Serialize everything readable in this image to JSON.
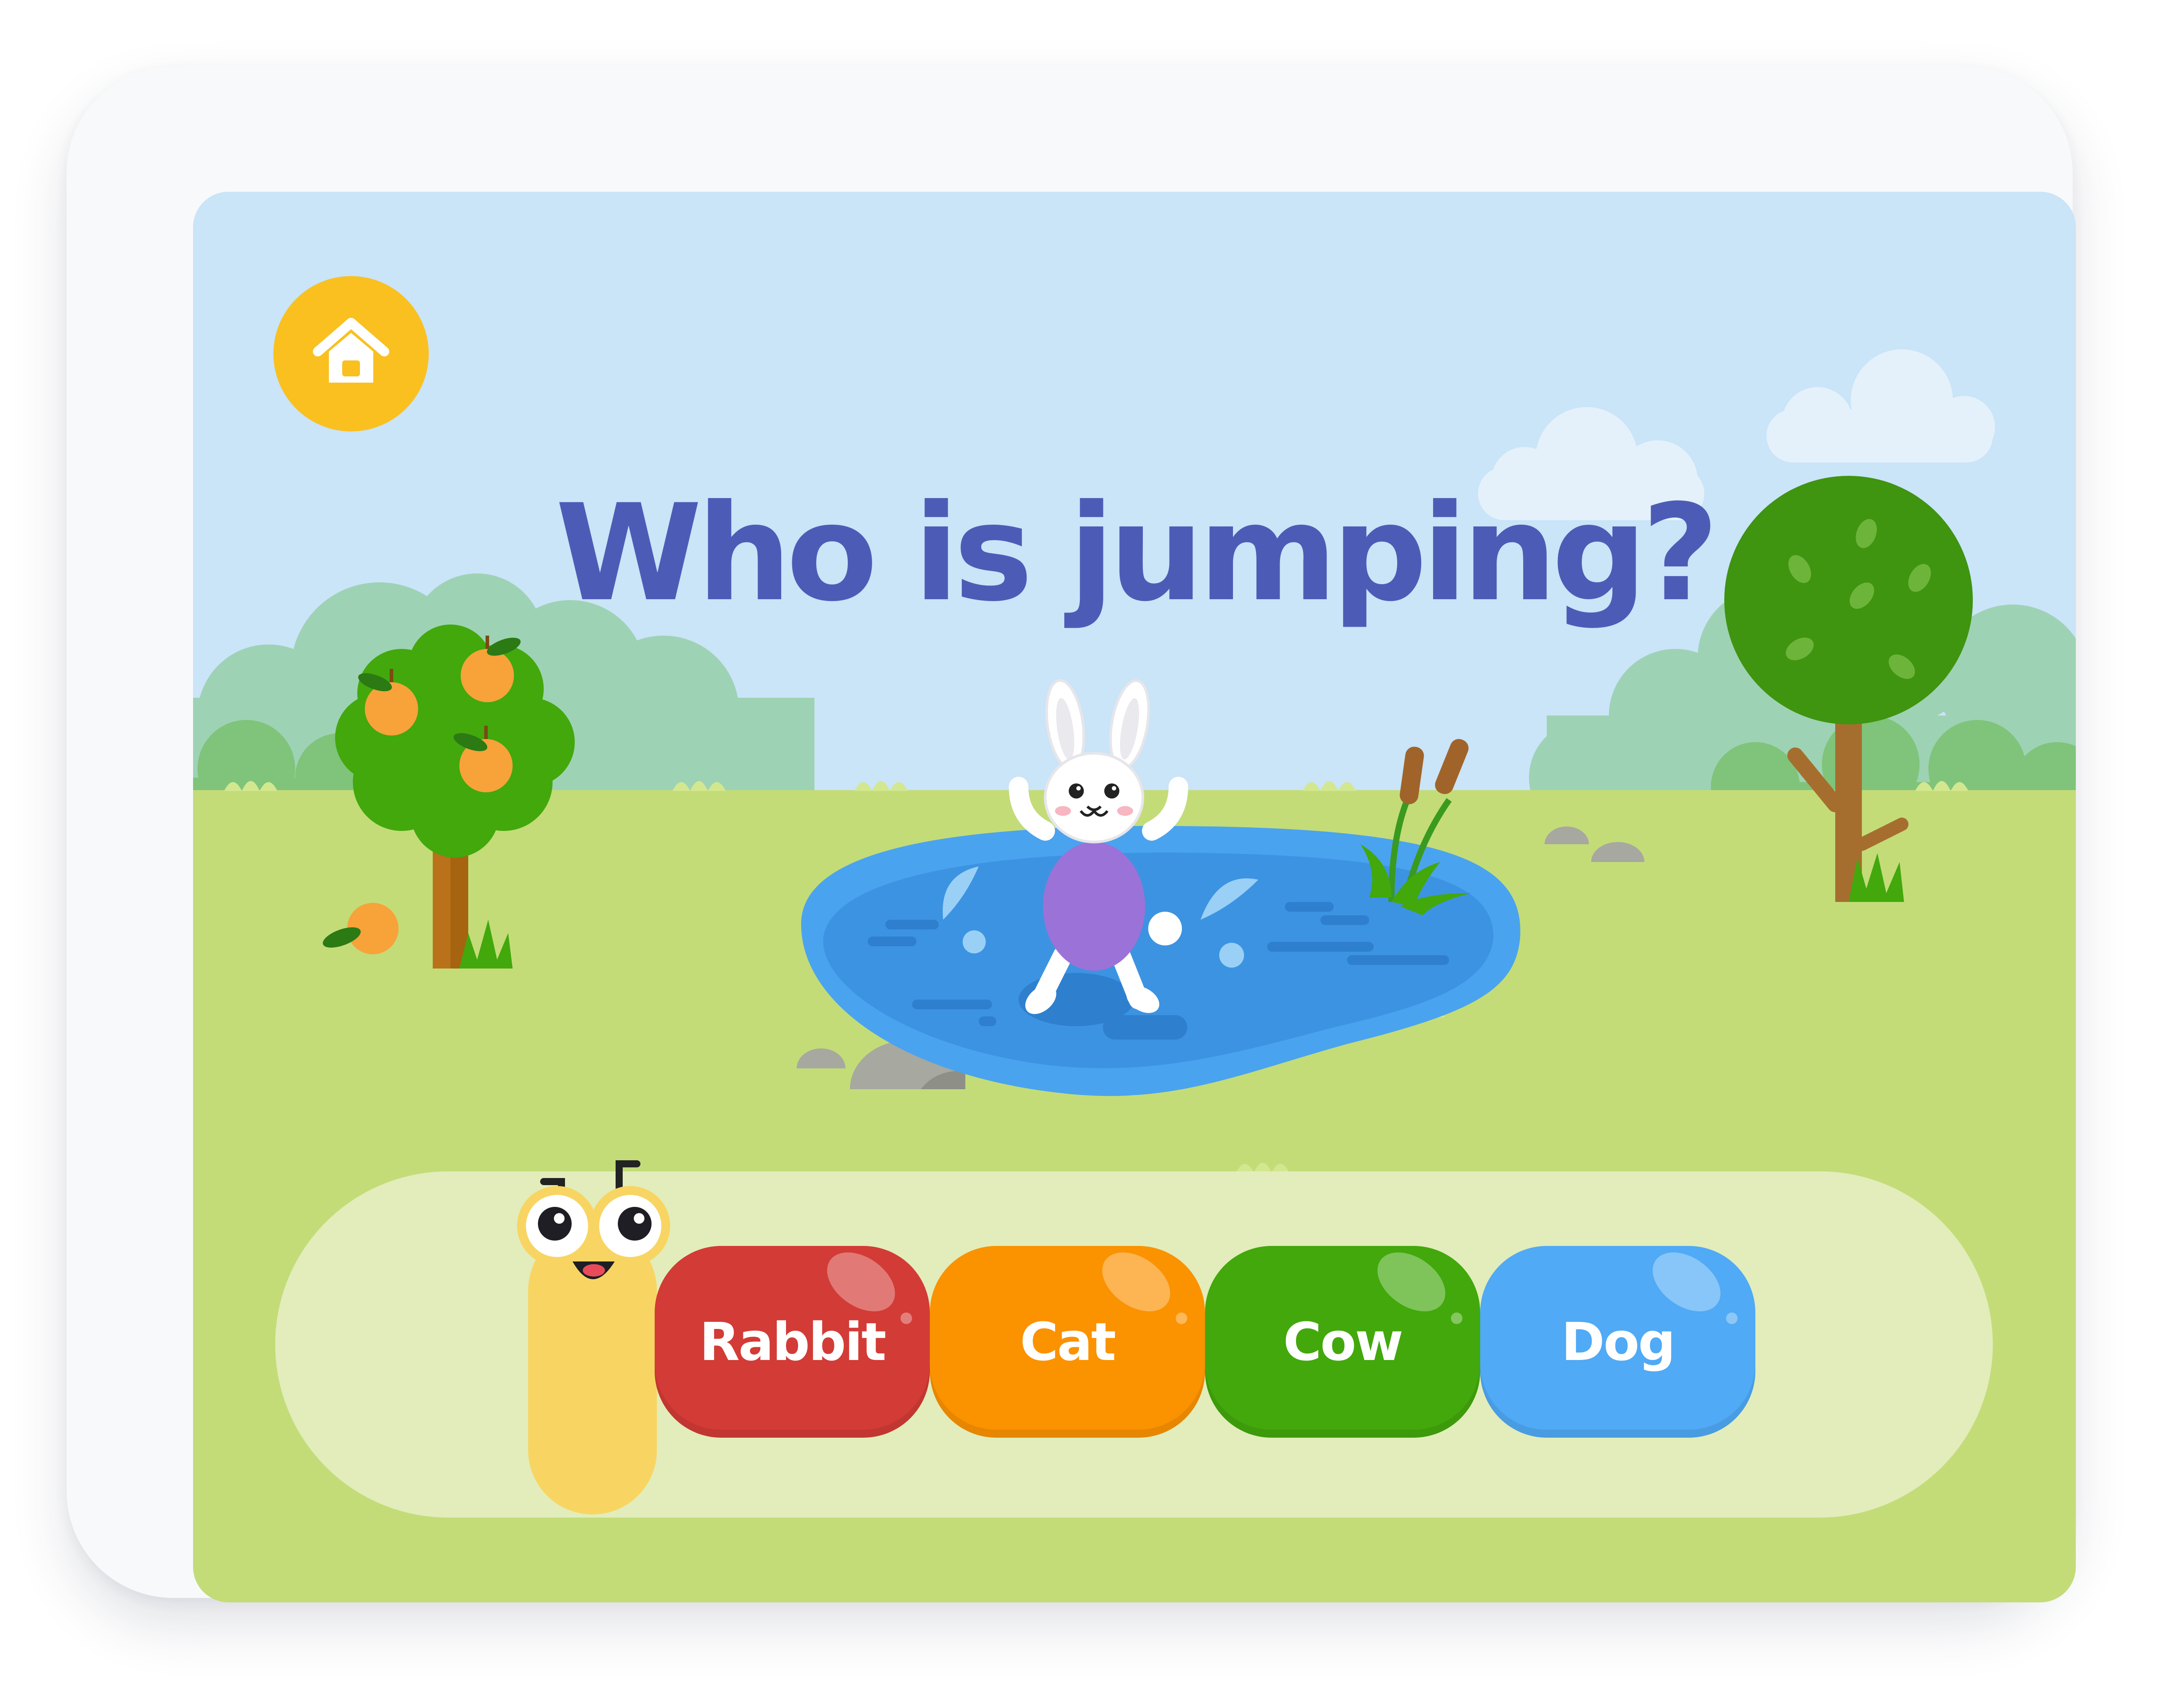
{
  "question": "Who is jumping?",
  "answers": [
    {
      "label": "Rabbit",
      "color": "#d33b36"
    },
    {
      "label": "Cat",
      "color": "#fb9200"
    },
    {
      "label": "Cow",
      "color": "#42a80c"
    },
    {
      "label": "Dog",
      "color": "#50aaf5"
    }
  ],
  "colors": {
    "sky": "#cae4f8",
    "grass": "#c3dc78",
    "tray": "#e2edbb",
    "home_button": "#f9c020",
    "question_text": "#4c5cb6",
    "pond": "#4aa3ee",
    "rabbit_shirt": "#9b72d8",
    "caterpillar": "#f8d562"
  },
  "icons": [
    "home-icon"
  ]
}
